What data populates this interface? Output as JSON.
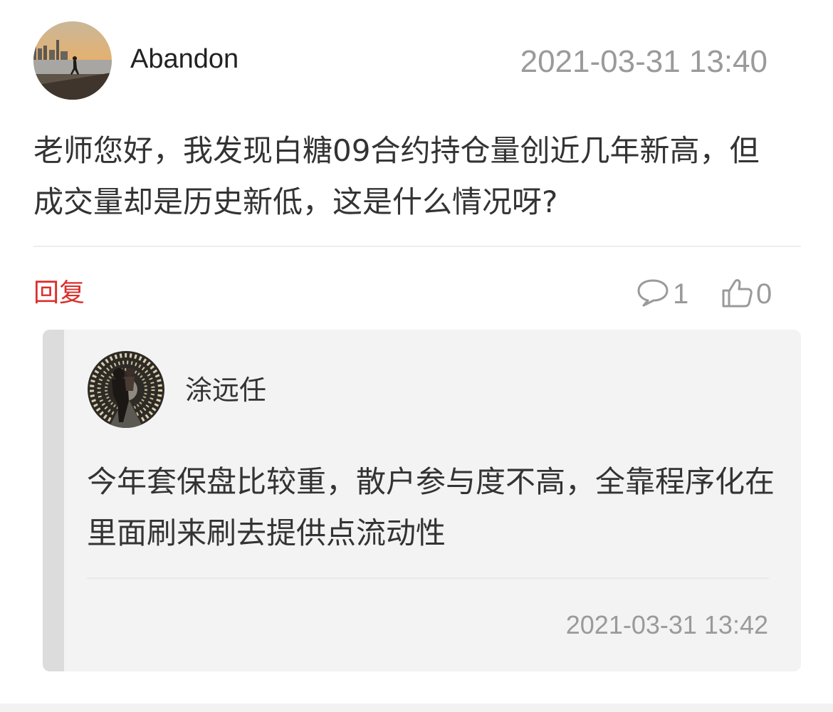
{
  "post": {
    "author": "Abandon",
    "time": "2021-03-31 13:40",
    "body": "老师您好，我发现白糖09合约持仓量创近几年新高，但成交量却是历史新低，这是什么情况呀?",
    "reply_label": "回复",
    "comment_count": "1",
    "like_count": "0"
  },
  "reply": {
    "author": "涂远任",
    "body": "今年套保盘比较重，散户参与度不高，全靠程序化在里面刷来刷去提供点流动性",
    "time": "2021-03-31 13:42"
  },
  "icons": {
    "comment": "speech-bubble-icon",
    "like": "thumbs-up-icon"
  },
  "colors": {
    "accent_red": "#d9302c",
    "muted_gray": "#9a9a9a",
    "card_bg": "#f3f3f3"
  }
}
